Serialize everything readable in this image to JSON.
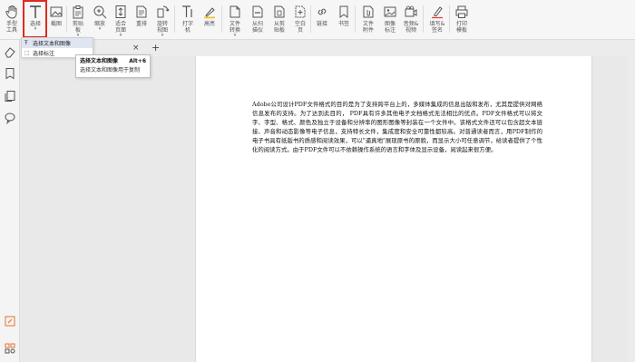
{
  "toolbar": {
    "tools": [
      {
        "label": "手型工具",
        "icon": "hand-icon"
      },
      {
        "label": "选择",
        "icon": "text-cursor-icon",
        "has_menu": true
      },
      {
        "label": "截图",
        "icon": "screenshot-icon"
      },
      {
        "label": "剪贴板",
        "icon": "clipboard-icon",
        "has_menu": true
      },
      {
        "label": "缩放",
        "icon": "zoom-icon",
        "has_menu": true
      },
      {
        "label": "适合页面",
        "icon": "fit-page-icon",
        "has_menu": true
      },
      {
        "label": "重排",
        "icon": "reflow-icon"
      },
      {
        "label": "旋转视图",
        "icon": "rotate-icon",
        "has_menu": true
      },
      {
        "label": "打字机",
        "icon": "typewriter-icon"
      },
      {
        "label": "高亮",
        "icon": "highlight-icon"
      },
      {
        "label": "文件转换",
        "icon": "file-convert-icon",
        "has_menu": true
      },
      {
        "label": "从扫描仪",
        "icon": "scanner-icon"
      },
      {
        "label": "从剪贴板",
        "icon": "from-clipboard-icon"
      },
      {
        "label": "空白页",
        "icon": "blank-page-icon"
      },
      {
        "label": "链接",
        "icon": "link-icon"
      },
      {
        "label": "书签",
        "icon": "bookmark-icon"
      },
      {
        "label": "文件附件",
        "icon": "attachment-icon"
      },
      {
        "label": "图像标注",
        "icon": "image-annotation-icon"
      },
      {
        "label": "音频&视频",
        "icon": "audio-video-icon"
      },
      {
        "label": "填写&签名",
        "icon": "fill-sign-icon"
      },
      {
        "label": "打印模板",
        "icon": "print-template-icon"
      }
    ]
  },
  "select_menu": {
    "items": [
      {
        "label": "选择文本和图像",
        "icon": "text-select-icon"
      },
      {
        "label": "选择标注",
        "icon": "annotation-select-icon"
      }
    ]
  },
  "tooltip": {
    "title": "选择文本和图像",
    "shortcut": "Alt+6",
    "description": "选择文本和图像用于复制"
  },
  "tabbar": {
    "close_glyph": "×",
    "new_tab_glyph": "+"
  },
  "document": {
    "paragraph": "Adobe公司设计PDF文件格式的目的是为了支持跨平台上的，多媒体集成的信息出版和发布，尤其是提供对网络信息发布的支持。为了达到此目的， PDF具有许多其他电子文档格式无法相比的优点。PDF文件格式可以将文字、字型、格式、颜色及独立于设备和分辨率的图形图像等封装在一个文件中。该格式文件还可以包含超文本链接、声音和动态影像等电子信息，支持特长文件，集成度和安全可靠性都较高。对普通读者而言，用PDF制作的电子书具有纸版书的质感和阅读效果，可以\"逼真地\"展现原书的原貌，而显示大小可任意调节，给读者提供了个性化的阅读方式。由于PDF文件可以不依赖操作系统的语言和字体及显示设备，阅读起来很方便。"
  },
  "colors": {
    "selection_highlight": "#e02a1f",
    "ribbon_bg": "#f6f6f6",
    "menu_active": "#dfe6f2"
  }
}
